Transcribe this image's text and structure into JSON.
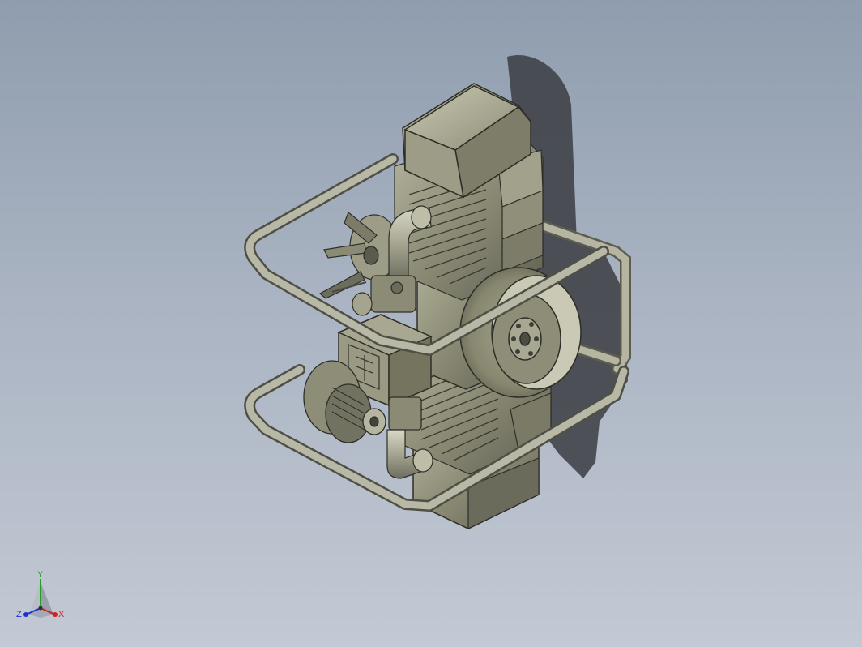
{
  "viewport": {
    "background_top": "#8f9dae",
    "background_bottom": "#c3c9d4"
  },
  "model": {
    "body_color": "#8a8a74",
    "body_dark": "#55554a",
    "body_light": "#b9b9a2",
    "frame_color": "#a9a997",
    "shadow_color": "#3b3d42"
  },
  "triad": {
    "x_label": "X",
    "y_label": "Y",
    "z_label": "Z",
    "x_color": "#d02020",
    "y_color": "#20a020",
    "z_color": "#2030d0"
  }
}
